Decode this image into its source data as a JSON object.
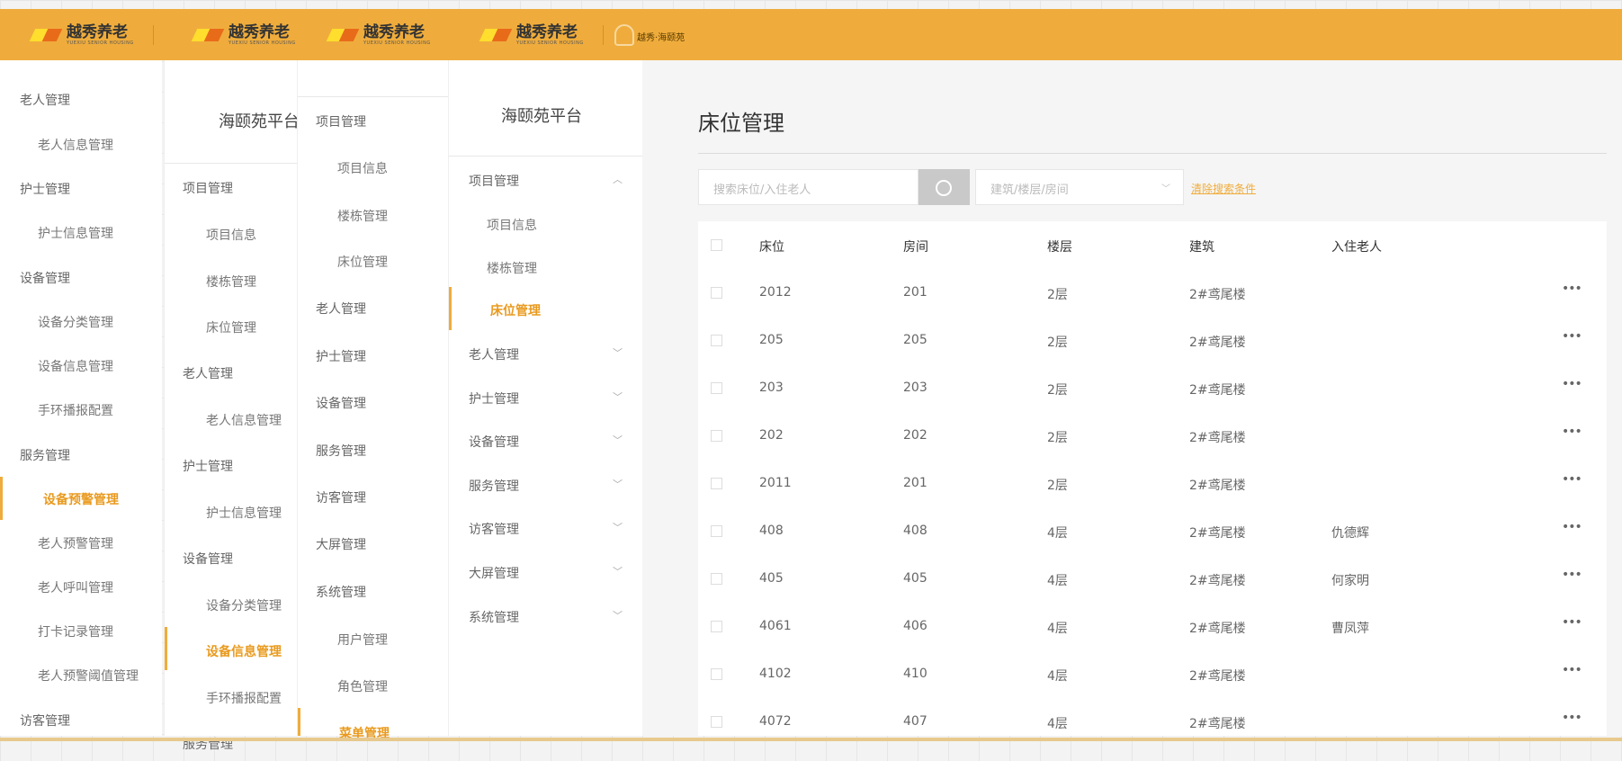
{
  "brand": {
    "name": "越秀养老",
    "sub": "YUEXIU SENIOR HOUSING",
    "user_label": "越秀·海颐苑"
  },
  "panel1": {
    "items": [
      {
        "label": "老人管理"
      },
      {
        "label": "老人信息管理"
      },
      {
        "label": "护士管理"
      },
      {
        "label": "护士信息管理"
      },
      {
        "label": "设备管理"
      },
      {
        "label": "设备分类管理"
      },
      {
        "label": "设备信息管理"
      },
      {
        "label": "手环播报配置"
      },
      {
        "label": "服务管理"
      },
      {
        "label": "设备预警管理"
      },
      {
        "label": "老人预警管理"
      },
      {
        "label": "老人呼叫管理"
      },
      {
        "label": "打卡记录管理"
      },
      {
        "label": "老人预警阈值管理"
      },
      {
        "label": "访客管理"
      }
    ]
  },
  "panel2": {
    "title": "海颐苑平台",
    "items": [
      {
        "label": "项目管理"
      },
      {
        "label": "项目信息"
      },
      {
        "label": "楼栋管理"
      },
      {
        "label": "床位管理"
      },
      {
        "label": "老人管理"
      },
      {
        "label": "老人信息管理"
      },
      {
        "label": "护士管理"
      },
      {
        "label": "护士信息管理"
      },
      {
        "label": "设备管理"
      },
      {
        "label": "设备分类管理"
      },
      {
        "label": "设备信息管理"
      },
      {
        "label": "手环播报配置"
      },
      {
        "label": "服务管理"
      }
    ]
  },
  "panel3": {
    "items": [
      {
        "label": "项目管理"
      },
      {
        "label": "项目信息"
      },
      {
        "label": "楼栋管理"
      },
      {
        "label": "床位管理"
      },
      {
        "label": "老人管理"
      },
      {
        "label": "护士管理"
      },
      {
        "label": "设备管理"
      },
      {
        "label": "服务管理"
      },
      {
        "label": "访客管理"
      },
      {
        "label": "大屏管理"
      },
      {
        "label": "系统管理"
      },
      {
        "label": "用户管理"
      },
      {
        "label": "角色管理"
      },
      {
        "label": "菜单管理"
      }
    ]
  },
  "panel4": {
    "title": "海颐苑平台",
    "items": [
      {
        "label": "项目管理"
      },
      {
        "label": "项目信息"
      },
      {
        "label": "楼栋管理"
      },
      {
        "label": "床位管理"
      },
      {
        "label": "老人管理"
      },
      {
        "label": "护士管理"
      },
      {
        "label": "设备管理"
      },
      {
        "label": "服务管理"
      },
      {
        "label": "访客管理"
      },
      {
        "label": "大屏管理"
      },
      {
        "label": "系统管理"
      }
    ]
  },
  "main": {
    "title": "床位管理",
    "search_placeholder": "搜索床位/入住老人",
    "filter_placeholder": "建筑/楼层/房间",
    "clear_label": "清除搜索条件",
    "columns": [
      "床位",
      "房间",
      "楼层",
      "建筑",
      "入住老人"
    ],
    "rows": [
      {
        "bed": "2012",
        "room": "201",
        "floor": "2层",
        "building": "2#鸢尾楼",
        "resident": ""
      },
      {
        "bed": "205",
        "room": "205",
        "floor": "2层",
        "building": "2#鸢尾楼",
        "resident": ""
      },
      {
        "bed": "203",
        "room": "203",
        "floor": "2层",
        "building": "2#鸢尾楼",
        "resident": ""
      },
      {
        "bed": "202",
        "room": "202",
        "floor": "2层",
        "building": "2#鸢尾楼",
        "resident": ""
      },
      {
        "bed": "2011",
        "room": "201",
        "floor": "2层",
        "building": "2#鸢尾楼",
        "resident": ""
      },
      {
        "bed": "408",
        "room": "408",
        "floor": "4层",
        "building": "2#鸢尾楼",
        "resident": "仇德辉"
      },
      {
        "bed": "405",
        "room": "405",
        "floor": "4层",
        "building": "2#鸢尾楼",
        "resident": "何家明"
      },
      {
        "bed": "4061",
        "room": "406",
        "floor": "4层",
        "building": "2#鸢尾楼",
        "resident": "曹凤萍"
      },
      {
        "bed": "4102",
        "room": "410",
        "floor": "4层",
        "building": "2#鸢尾楼",
        "resident": ""
      },
      {
        "bed": "4072",
        "room": "407",
        "floor": "4层",
        "building": "2#鸢尾楼",
        "resident": ""
      }
    ],
    "more_label": "•••"
  }
}
